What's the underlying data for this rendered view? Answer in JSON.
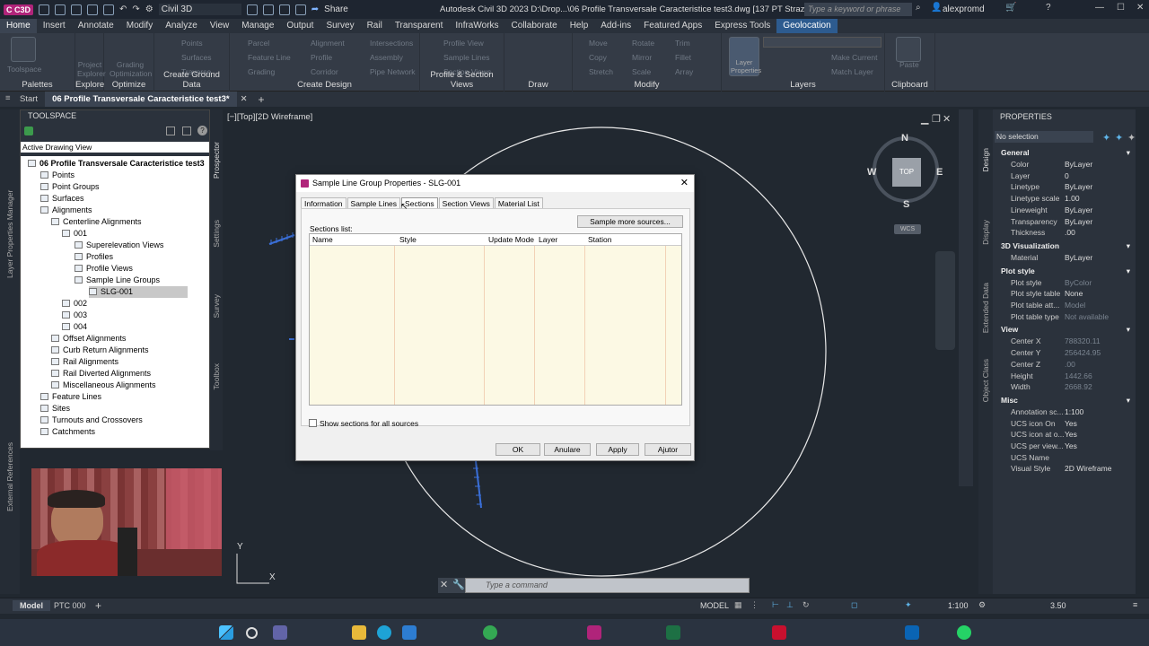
{
  "app": {
    "workspace": "Civil 3D",
    "title": "Autodesk Civil 3D 2023    D:\\Drop...\\06 Profile Transversale Caracteristice test3.dwg [137 PT Strazi Vama Veche 2]",
    "search_placeholder": "Type a keyword or phrase",
    "user": "alexpromd",
    "share": "Share",
    "logo": "C C3D"
  },
  "menu_tabs": [
    "Home",
    "Insert",
    "Annotate",
    "Modify",
    "Analyze",
    "View",
    "Manage",
    "Output",
    "Survey",
    "Rail",
    "Transparent",
    "InfraWorks",
    "Collaborate",
    "Help",
    "Add-ins",
    "Featured Apps",
    "Express Tools",
    "Geolocation"
  ],
  "ribbon": {
    "groups": [
      "Palettes",
      "Explore",
      "Optimize",
      "Create Ground Data",
      "Create Design",
      "Profile & Section Views",
      "Draw",
      "Modify",
      "Layers",
      "Clipboard"
    ],
    "buttons": {
      "toolspace": "Toolspace",
      "project_explorer": "Project Explorer",
      "grading_optimization": "Grading Optimization",
      "points": "Points",
      "surfaces": "Surfaces",
      "traverse": "Traverse",
      "parcel": "Parcel",
      "feature_line": "Feature Line",
      "grading": "Grading",
      "alignment": "Alignment",
      "profile": "Profile",
      "corridor": "Corridor",
      "intersections": "Intersections",
      "assembly": "Assembly",
      "pipe_network": "Pipe Network",
      "profile_view": "Profile View",
      "sample_lines": "Sample Lines",
      "section_views": "Section Views",
      "move": "Move",
      "copy": "Copy",
      "stretch": "Stretch",
      "rotate": "Rotate",
      "mirror": "Mirror",
      "scale": "Scale",
      "trim": "Trim",
      "fillet": "Fillet",
      "array": "Array",
      "layer_properties": "Layer Properties",
      "make_current": "Make Current",
      "match_layer": "Match Layer",
      "paste": "Paste"
    }
  },
  "doc_tabs": {
    "start": "Start",
    "active": "06 Profile Transversale Caracteristice test3*"
  },
  "toolspace": {
    "title": "TOOLSPACE",
    "view": "Active Drawing View",
    "side_tabs": [
      "Prospector",
      "Settings",
      "Survey",
      "Toolbox"
    ],
    "left_tabs": [
      "Layer Properties Manager",
      "External References"
    ],
    "tree": [
      "06 Profile Transversale Caracteristice test3",
      "Points",
      "Point Groups",
      "Surfaces",
      "Alignments",
      "Centerline Alignments",
      "001",
      "Superelevation Views",
      "Profiles",
      "Profile Views",
      "Sample Line Groups",
      "SLG-001",
      "002",
      "003",
      "004",
      "Offset Alignments",
      "Curb Return Alignments",
      "Rail Alignments",
      "Rail Diverted Alignments",
      "Miscellaneous Alignments",
      "Feature Lines",
      "Sites",
      "Turnouts and Crossovers",
      "Catchments"
    ]
  },
  "viewport": {
    "label": "[−][Top][2D Wireframe]",
    "compass": {
      "n": "N",
      "s": "S",
      "e": "E",
      "w": "W",
      "top": "TOP",
      "wcs": "WCS"
    },
    "ucs_x": "X",
    "ucs_y": "Y"
  },
  "dialog": {
    "title": "Sample Line Group Properties - SLG-001",
    "tabs": [
      "Information",
      "Sample Lines",
      "Sections",
      "Section Views",
      "Material List"
    ],
    "active_tab": "Sections",
    "sample_more": "Sample more sources...",
    "sections_list": "Sections list:",
    "columns": [
      "Name",
      "Style",
      "Update Mode",
      "Layer",
      "Station"
    ],
    "show_all": "Show sections for all sources",
    "ok": "OK",
    "cancel": "Anulare",
    "apply": "Apply",
    "help": "Ajutor"
  },
  "properties": {
    "title": "PROPERTIES",
    "selection": "No selection",
    "side_tabs": [
      "Design",
      "Display",
      "Extended Data",
      "Object Class"
    ],
    "sections": [
      {
        "name": "General",
        "rows": [
          [
            "Color",
            "ByLayer"
          ],
          [
            "Layer",
            "0"
          ],
          [
            "Linetype",
            "ByLayer"
          ],
          [
            "Linetype scale",
            "1.00"
          ],
          [
            "Lineweight",
            "ByLayer"
          ],
          [
            "Transparency",
            "ByLayer"
          ],
          [
            "Thickness",
            ".00"
          ]
        ]
      },
      {
        "name": "3D Visualization",
        "rows": [
          [
            "Material",
            "ByLayer"
          ]
        ]
      },
      {
        "name": "Plot style",
        "rows": [
          [
            "Plot style",
            "ByColor"
          ],
          [
            "Plot style table",
            "None"
          ],
          [
            "Plot table att...",
            "Model"
          ],
          [
            "Plot table type",
            "Not available"
          ]
        ]
      },
      {
        "name": "View",
        "rows": [
          [
            "Center X",
            "788320.11"
          ],
          [
            "Center Y",
            "256424.95"
          ],
          [
            "Center Z",
            ".00"
          ],
          [
            "Height",
            "1442.66"
          ],
          [
            "Width",
            "2668.92"
          ]
        ]
      },
      {
        "name": "Misc",
        "rows": [
          [
            "Annotation sc...",
            "1:100"
          ],
          [
            "UCS icon On",
            "Yes"
          ],
          [
            "UCS icon at o...",
            "Yes"
          ],
          [
            "UCS per view...",
            "Yes"
          ],
          [
            "UCS Name",
            ""
          ],
          [
            "Visual Style",
            "2D Wireframe"
          ]
        ]
      }
    ]
  },
  "command": {
    "placeholder": "Type a command"
  },
  "status": {
    "model_tab": "Model",
    "layout_tab": "PTC 000",
    "model": "MODEL",
    "scale": "1:100",
    "value": "3.50"
  },
  "colors": {
    "accent": "#2d5b8f",
    "bg": "#212830",
    "dialog_grid": "#fcf9e4",
    "circle": "#e8e8e8",
    "alignment": "#3a6fd8"
  }
}
